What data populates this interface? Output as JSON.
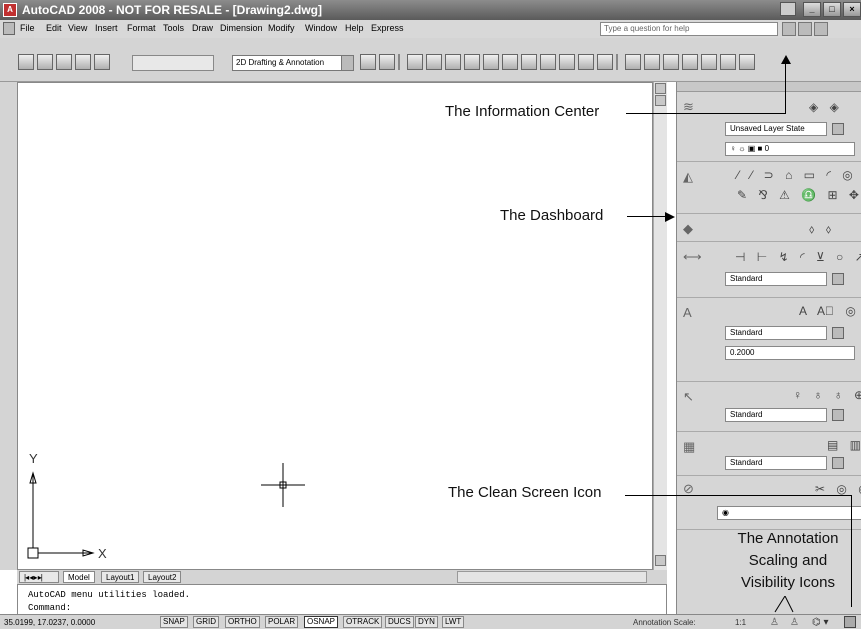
{
  "window": {
    "title": "AutoCAD 2008 - NOT FOR RESALE - [Drawing2.dwg]",
    "app_icon": "autocad-logo-icon"
  },
  "menubar": {
    "items": [
      "File",
      "Edit",
      "View",
      "Insert",
      "Format",
      "Tools",
      "Draw",
      "Dimension",
      "Modify",
      "Window",
      "Help",
      "Express"
    ],
    "search_placeholder": "Type a question for help"
  },
  "toolbar": {
    "workspace": "2D Drafting & Annotation"
  },
  "dashboard": {
    "layer_state": "Unsaved Layer State",
    "layer": "0",
    "dim_style": "Standard",
    "text_style": "Standard",
    "text_height": "0.2000",
    "mleader_style": "Standard",
    "table_style": "Standard"
  },
  "tabs": [
    "Model",
    "Layout1",
    "Layout2"
  ],
  "command_line": {
    "line1": "AutoCAD menu utilities loaded.",
    "line2": "Command:"
  },
  "ucs": {
    "x": "X",
    "y": "Y"
  },
  "status": {
    "coords": "35.0199, 17.0237, 0.0000",
    "buttons": [
      "SNAP",
      "GRID",
      "ORTHO",
      "POLAR",
      "OSNAP",
      "OTRACK",
      "DUCS",
      "DYN",
      "LWT"
    ],
    "annotation_scale_label": "Annotation Scale:",
    "annotation_scale_value": "1:1"
  },
  "callouts": {
    "info_center": "The Information Center",
    "dashboard": "The Dashboard",
    "clean_screen": "The Clean Screen Icon",
    "annotation_line1": "The Annotation",
    "annotation_line2": "Scaling and",
    "annotation_line3": "Visibility Icons"
  }
}
